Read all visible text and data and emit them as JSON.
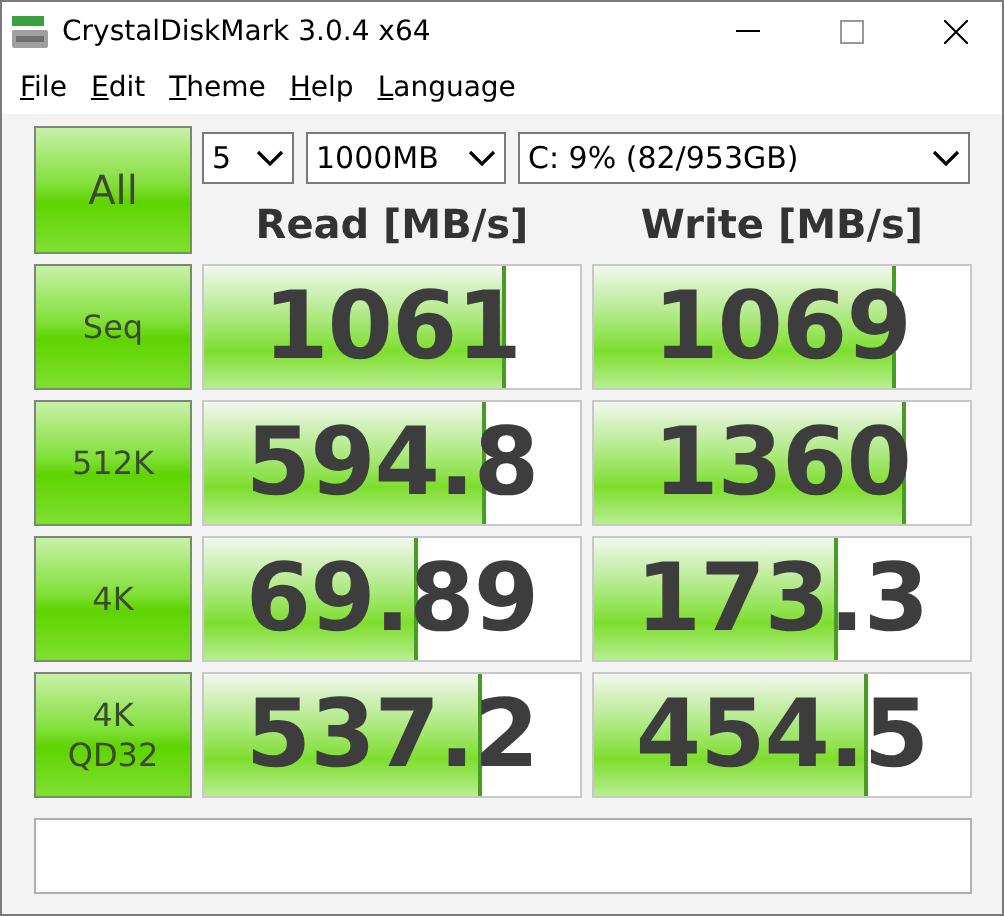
{
  "window": {
    "title": "CrystalDiskMark 3.0.4 x64"
  },
  "menu": [
    "File",
    "Edit",
    "Theme",
    "Help",
    "Language"
  ],
  "all_button": "All",
  "selects": [
    {
      "kind": "count",
      "value": "5"
    },
    {
      "kind": "size",
      "value": "1000MB"
    },
    {
      "kind": "drive",
      "value": "C: 9% (82/953GB)"
    }
  ],
  "headers": [
    "Read [MB/s]",
    "Write [MB/s]"
  ],
  "rows": [
    {
      "label": [
        "Seq"
      ],
      "read": {
        "value": "1061",
        "level": 0.79
      },
      "write": {
        "value": "1069",
        "level": 0.79
      }
    },
    {
      "label": [
        "512K"
      ],
      "read": {
        "value": "594.8",
        "level": 0.74
      },
      "write": {
        "value": "1360",
        "level": 0.82
      }
    },
    {
      "label": [
        "4K"
      ],
      "read": {
        "value": "69.89",
        "level": 0.56
      },
      "write": {
        "value": "173.3",
        "level": 0.64
      }
    },
    {
      "label": [
        "4K",
        "QD32"
      ],
      "read": {
        "value": "537.2",
        "level": 0.73
      },
      "write": {
        "value": "454.5",
        "level": 0.72
      }
    }
  ]
}
